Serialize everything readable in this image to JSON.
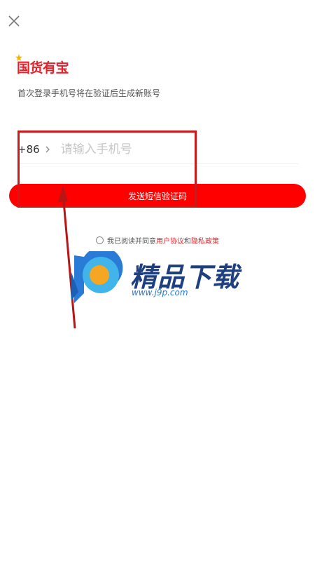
{
  "header": {
    "close_icon": "close-icon"
  },
  "brand": {
    "logo_text": "国货有宝",
    "accent_color": "#e8202a"
  },
  "login": {
    "subtitle": "首次登录手机号将在验证后生成新账号",
    "country_code": "+86",
    "phone_placeholder": "请输入手机号",
    "phone_value": "",
    "send_code_label": "发送短信验证码",
    "button_color": "#ff0000"
  },
  "agreement": {
    "prefix": "我已阅读并同意",
    "user_agreement": "用户协议",
    "and": "和",
    "privacy_policy": "隐私政策",
    "checked": false
  },
  "watermark": {
    "brand": "精品下载",
    "url": "www.j9p.com"
  }
}
